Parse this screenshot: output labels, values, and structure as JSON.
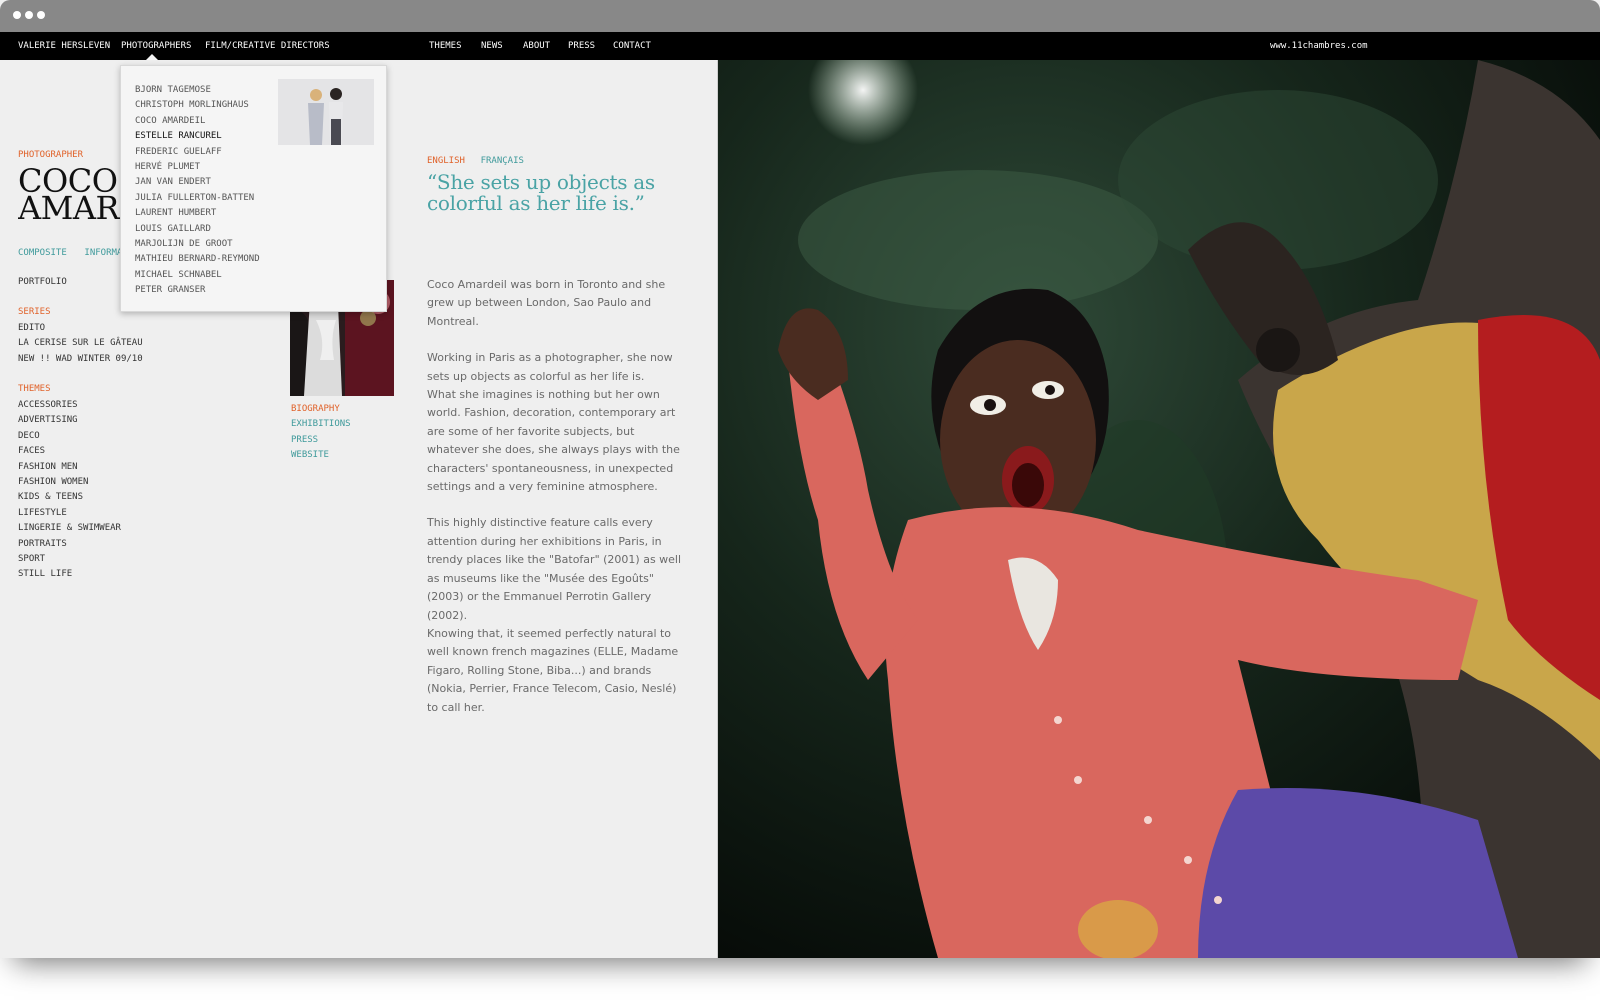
{
  "site": {
    "url": "www.11chambres.com"
  },
  "nav": {
    "items": [
      {
        "label": "VALERIE HERSLEVEN"
      },
      {
        "label": "PHOTOGRAPHERS"
      },
      {
        "label": "FILM/CREATIVE DIRECTORS"
      },
      {
        "label": "THEMES"
      },
      {
        "label": "NEWS"
      },
      {
        "label": "ABOUT"
      },
      {
        "label": "PRESS"
      },
      {
        "label": "CONTACT"
      }
    ]
  },
  "dropdown": {
    "photographers": [
      "BJORN TAGEMOSE",
      "CHRISTOPH MORLINGHAUS",
      "COCO AMARDEIL",
      "ESTELLE RANCUREL",
      "FREDERIC GUELAFF",
      "HERVÉ PLUMET",
      "JAN VAN ENDERT",
      "JULIA FULLERTON-BATTEN",
      "LAURENT HUMBERT",
      "LOUIS GAILLARD",
      "MARJOLIJN DE GROOT",
      "MATHIEU BERNARD-REYMOND",
      "MICHAEL SCHNABEL",
      "PETER GRANSER"
    ],
    "active_index": 3
  },
  "profile": {
    "role": "PHOTOGRAPHER",
    "name_line1": "COCO",
    "name_line2": "AMARDEIL",
    "tabs": [
      "COMPOSITE",
      "INFORMATION"
    ],
    "portfolio_label": "PORTFOLIO",
    "series_heading": "SERIES",
    "series": [
      "EDITO",
      "LA CERISE SUR LE GÂTEAU",
      "NEW !! WAD WINTER 09/10"
    ],
    "themes_heading": "THEMES",
    "themes": [
      "ACCESSORIES",
      "ADVERTISING",
      "DECO",
      "FACES",
      "FASHION MEN",
      "FASHION WOMEN",
      "KIDS & TEENS",
      "LIFESTYLE",
      "LINGERIE & SWIMWEAR",
      "PORTRAITS",
      "SPORT",
      "STILL LIFE"
    ],
    "info_links": [
      "BIOGRAPHY",
      "EXHIBITIONS",
      "PRESS",
      "WEBSITE"
    ]
  },
  "language": {
    "english": "ENGLISH",
    "french": "FRANÇAIS"
  },
  "quote": "“She sets up objects as colorful as her life is.”",
  "bio": {
    "p1": "Coco Amardeil was born in Toronto and she grew up between London, Sao Paulo and Montreal.",
    "p2a": "Working in Paris as a photographer, she now sets up objects as colorful as her life is.",
    "p2b": "What she imagines is nothing but her own world. Fashion, decoration, contemporary art are some of her favorite subjects, but whatever she does, she always plays with the characters' spontaneousness, in unexpected settings and a very feminine atmosphere.",
    "p3a": "This highly distinctive feature calls every attention during her exhibitions in Paris, in trendy places like the \"Batofar\" (2001) as well as museums like the \"Musée des Egoûts\" (2003) or the Emmanuel Perrotin Gallery (2002).",
    "p3b": "Knowing that, it seemed perfectly natural to well known french magazines (ELLE, Madame Figaro, Rolling Stone, Biba...) and brands (Nokia, Perrier, France Telecom, Casio, Neslé) to call her."
  },
  "colors": {
    "accent_orange": "#e0622a",
    "accent_teal": "#3f9a9b",
    "navbar": "#000000",
    "page_bg": "#efefef"
  }
}
